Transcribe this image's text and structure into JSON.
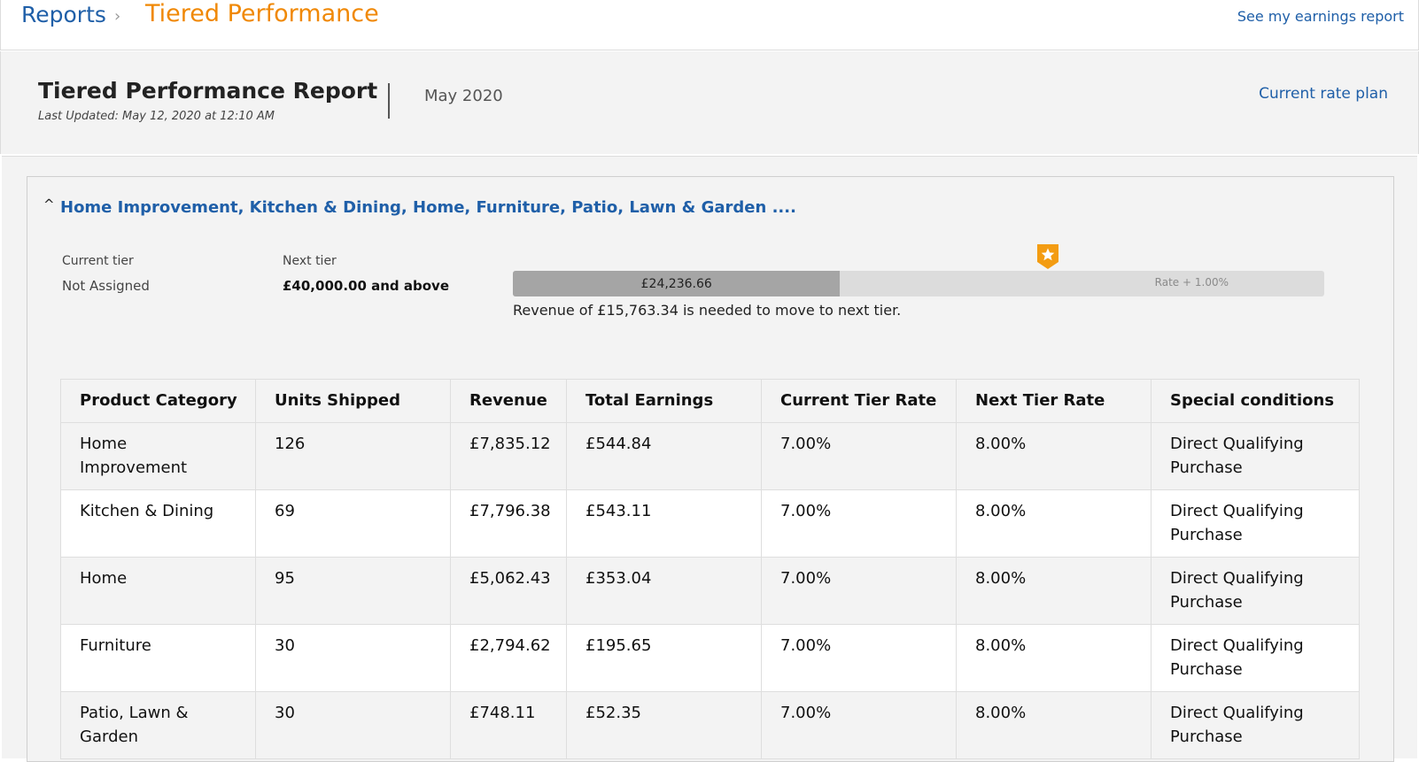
{
  "breadcrumb": {
    "reports_label": "Reports",
    "separator": "›",
    "current_label": "Tiered Performance",
    "earnings_link": "See my earnings report"
  },
  "header": {
    "title": "Tiered Performance Report",
    "last_updated": "Last Updated: May 12, 2020 at 12:10 AM",
    "month": "May 2020",
    "rate_plan_link": "Current rate plan"
  },
  "section": {
    "collapse_icon": "chevron-up-icon",
    "title": "Home Improvement, Kitchen & Dining, Home, Furniture, Patio, Lawn & Garden ....",
    "current_tier_label": "Current tier",
    "current_tier_value": "Not Assigned",
    "next_tier_label": "Next tier",
    "next_tier_value": "£40,000.00 and above",
    "progress": {
      "revenue_label": "£24,236.66",
      "fraction": 0.4033,
      "rate_label": "Rate + 1.00%",
      "marker_icon": "star-badge-icon",
      "needed_text": "Revenue of £15,763.34 is needed to move to next tier."
    }
  },
  "table": {
    "columns": [
      "Product Category",
      "Units Shipped",
      "Revenue",
      "Total Earnings",
      "Current Tier Rate",
      "Next Tier Rate",
      "Special conditions"
    ],
    "rows": [
      [
        "Home Improvement",
        "126",
        "£7,835.12",
        "£544.84",
        "7.00%",
        "8.00%",
        "Direct Qualifying Purchase"
      ],
      [
        "Kitchen & Dining",
        "69",
        "£7,796.38",
        "£543.11",
        "7.00%",
        "8.00%",
        "Direct Qualifying Purchase"
      ],
      [
        "Home",
        "95",
        "£5,062.43",
        "£353.04",
        "7.00%",
        "8.00%",
        "Direct Qualifying Purchase"
      ],
      [
        "Furniture",
        "30",
        "£2,794.62",
        "£195.65",
        "7.00%",
        "8.00%",
        "Direct Qualifying Purchase"
      ],
      [
        "Patio, Lawn & Garden",
        "30",
        "£748.11",
        "£52.35",
        "7.00%",
        "8.00%",
        "Direct Qualifying Purchase"
      ]
    ]
  },
  "colors": {
    "link": "#1f5fa8",
    "breadcrumb_current": "#f08804",
    "star_marker": "#f39c12",
    "progress_fill": "#a5a5a5",
    "progress_track": "#dcdcdc"
  }
}
